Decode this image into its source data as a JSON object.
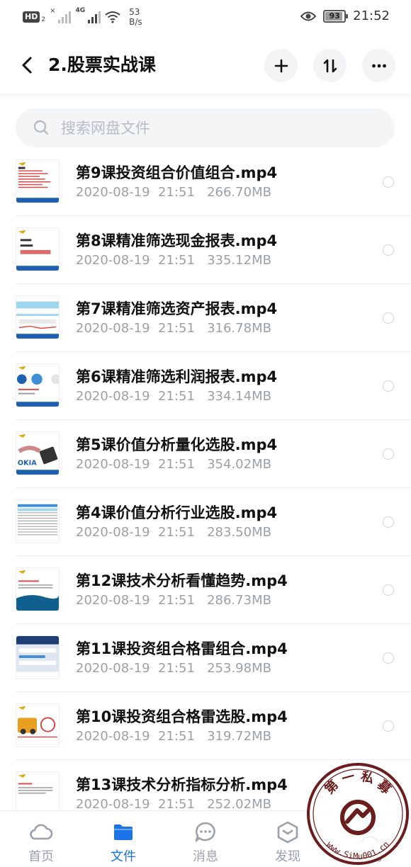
{
  "status_bar": {
    "hd": "HD",
    "hd_sub": "2",
    "sig_x": "×",
    "net": "4G",
    "speed_value": "53",
    "speed_unit": "B/s",
    "battery": "93",
    "battery_level": 0.93,
    "time": "21:52",
    "icons": [
      "hd-icon",
      "signal-icon",
      "wifi-icon",
      "eye-icon",
      "battery-icon"
    ]
  },
  "header": {
    "title": "2.股票实战课",
    "back_icon": "chevron-left-icon",
    "actions": [
      "add-icon",
      "sort-icon",
      "more-icon"
    ]
  },
  "search": {
    "placeholder": "搜索网盘文件",
    "icon": "search-icon"
  },
  "files": [
    {
      "name": "第9课投资组合价值组合.mp4",
      "meta": "2020-08-19  21:51   266.70MB"
    },
    {
      "name": "第8课精准筛选现金报表.mp4",
      "meta": "2020-08-19  21:51   335.12MB"
    },
    {
      "name": "第7课精准筛选资产报表.mp4",
      "meta": "2020-08-19  21:51   316.78MB"
    },
    {
      "name": "第6课精准筛选利润报表.mp4",
      "meta": "2020-08-19  21:51   334.14MB"
    },
    {
      "name": "第5课价值分析量化选股.mp4",
      "meta": "2020-08-19  21:51   354.02MB"
    },
    {
      "name": "第4课价值分析行业选股.mp4",
      "meta": "2020-08-19  21:51   283.50MB"
    },
    {
      "name": "第12课技术分析看懂趋势.mp4",
      "meta": "2020-08-19  21:51   286.73MB"
    },
    {
      "name": "第11课投资组合格雷组合.mp4",
      "meta": "2020-08-19  21:51   253.98MB"
    },
    {
      "name": "第10课投资组合格雷选股.mp4",
      "meta": "2020-08-19  21:51   319.72MB"
    },
    {
      "name": "第13课技术分析指标分析.mp4",
      "meta": "2020-08-19  21:51   252.02MB"
    }
  ],
  "tabs": [
    {
      "label": "首页",
      "icon": "cloud-icon",
      "active": false
    },
    {
      "label": "文件",
      "icon": "folder-icon",
      "active": true
    },
    {
      "label": "消息",
      "icon": "chat-icon",
      "active": false
    },
    {
      "label": "发现",
      "icon": "cube-icon",
      "active": false
    },
    {
      "label": "我的",
      "icon": "user-icon",
      "active": false
    }
  ],
  "watermark": {
    "text": "第一私募 www.SiMu001.cn"
  },
  "colors": {
    "accent": "#1a73e8",
    "meta_text": "#9ca0a8",
    "search_bg": "#f4f5f7"
  }
}
